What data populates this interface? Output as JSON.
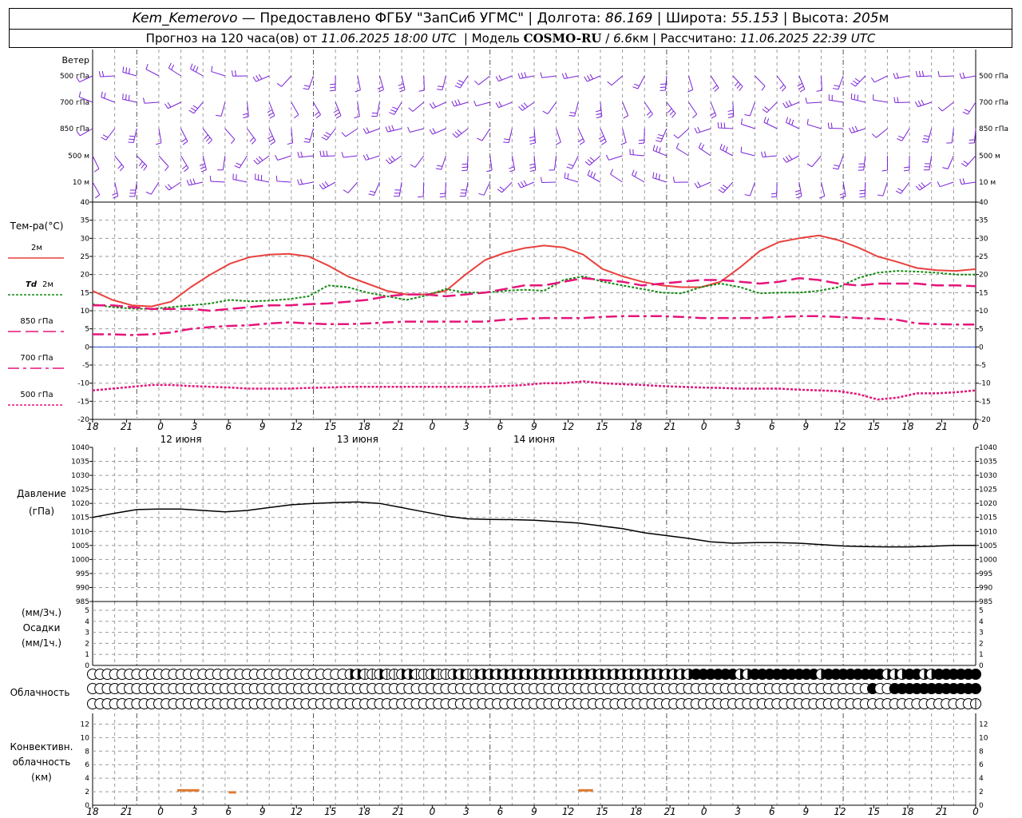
{
  "header": {
    "station": "Kem_Kemerovo",
    "dash": "—",
    "provider": "Предоставлено ФГБУ \"ЗапСиб УГМС\"",
    "lon_label": "Долгота:",
    "lon": "86.169",
    "lat_label": "Широта:",
    "lat": "55.153",
    "alt_label": "Высота:",
    "alt": "205",
    "alt_unit": "м",
    "forecast_prefix": "Прогноз на 120 часа(ов) от",
    "forecast_from": "11.06.2025 18:00 UTC",
    "model_label": "Модель",
    "model": "COSMO-RU",
    "resolution": "6.6",
    "res_unit": "км",
    "computed_label": "Рассчитано:",
    "computed": "11.06.2025 22:39 UTC"
  },
  "colors": {
    "t2m": "#e8413c",
    "td2m": "#118a11",
    "t850": "#e6147a",
    "t700": "#e6147a",
    "t500": "#e6147a",
    "wind": "#7a22d8",
    "zero_line": "#2b4fd8",
    "conv_cloud": "#e07a30",
    "pressure": "#000000",
    "grid": "#9a9a9a"
  },
  "time_axis": {
    "hour_ticks": [
      "18",
      "21",
      "0",
      "3",
      "6",
      "9",
      "12",
      "15",
      "18",
      "21",
      "0",
      "3",
      "6",
      "9",
      "12",
      "15",
      "18",
      "21",
      "0",
      "3",
      "6",
      "9",
      "12",
      "15",
      "18",
      "21",
      "0"
    ],
    "day_labels": [
      {
        "label": "12 июня",
        "hour": 12
      },
      {
        "label": "13 июня",
        "hour": 36
      },
      {
        "label": "14 июня",
        "hour": 60
      }
    ]
  },
  "wind_panel": {
    "title": "Ветер",
    "levels": [
      "500 гПа",
      "700 гПа",
      "850 гПа",
      "500 м",
      "10 м"
    ]
  },
  "temperature_panel": {
    "title": "Тем-ра(°C)",
    "legend": [
      {
        "key": "t2m",
        "label": "2м",
        "dash": "solid"
      },
      {
        "key": "td2m",
        "label_a": "Td",
        "label_b": "2м",
        "dash": "dotted"
      },
      {
        "key": "t850",
        "label": "850 гПа",
        "dash": "long-dash"
      },
      {
        "key": "t700",
        "label": "700 гПа",
        "dash": "dash-dot"
      },
      {
        "key": "t500",
        "label": "500 гПа",
        "dash": "dotted"
      }
    ],
    "ticks": [
      "40",
      "35",
      "30",
      "25",
      "20",
      "15",
      "10",
      "5",
      "0",
      "-5",
      "-10",
      "-15",
      "-20"
    ]
  },
  "pressure_panel": {
    "title": "Давление",
    "unit": "(гПа)",
    "ticks": [
      "1040",
      "1035",
      "1030",
      "1025",
      "1020",
      "1015",
      "1010",
      "1005",
      "1000",
      "995",
      "990",
      "985"
    ]
  },
  "precip_panel": {
    "line1": "(мм/3ч.)",
    "line2": "Осадки",
    "line3": "(мм/1ч.)",
    "ticks": [
      "5",
      "4",
      "3",
      "2",
      "1",
      "0"
    ]
  },
  "cloud_panel": {
    "title": "Облачность"
  },
  "convective_panel": {
    "line1": "Конвективн.",
    "line2": "облачность",
    "line3": "(км)",
    "ticks": [
      "12",
      "10",
      "8",
      "6",
      "4",
      "2",
      "0"
    ]
  },
  "chart_data": [
    {
      "type": "line",
      "name": "temperature",
      "x_unit": "hours from 11.06.2025 18:00 UTC",
      "ylim": [
        -20,
        40
      ],
      "x": [
        0,
        3,
        6,
        9,
        12,
        15,
        18,
        21,
        24,
        27,
        30,
        33,
        36,
        39,
        42,
        45,
        48,
        51,
        54,
        57,
        60,
        63,
        66,
        69,
        72,
        75,
        78,
        81,
        84,
        87,
        90,
        93,
        96,
        99,
        102,
        105,
        108,
        111,
        114,
        117,
        120
      ],
      "series": [
        {
          "name": "2м",
          "values": [
            15.5,
            13.0,
            11.5,
            11.2,
            12.5,
            16.5,
            20.0,
            23.0,
            24.8,
            25.5,
            25.7,
            25.0,
            22.5,
            19.5,
            17.5,
            15.5,
            14.5,
            14.5,
            15.5,
            20.0,
            24.0,
            26.0,
            27.3,
            28.0,
            27.5,
            25.5,
            21.5,
            19.5,
            18.0,
            17.0,
            16.5,
            16.5,
            18.0,
            22.0,
            26.5,
            29.0,
            30.0,
            30.8,
            29.5,
            27.5,
            25.0,
            23.5,
            21.8,
            21.2,
            21.0,
            21.5
          ]
        },
        {
          "name": "Td 2м",
          "values": [
            11.8,
            11.0,
            10.6,
            10.5,
            11.0,
            11.5,
            12.0,
            13.0,
            12.6,
            12.8,
            13.2,
            14.0,
            17.0,
            16.5,
            15.0,
            14.0,
            13.0,
            14.2,
            16.0,
            15.0,
            15.0,
            15.5,
            15.8,
            15.5,
            18.5,
            19.5,
            18.0,
            17.0,
            16.0,
            15.0,
            14.8,
            16.5,
            17.5,
            16.5,
            14.8,
            15.0,
            15.0,
            15.5,
            16.5,
            19.0,
            20.5,
            21.0,
            20.8,
            20.5,
            20.0,
            20.0
          ]
        },
        {
          "name": "850 гПа",
          "values": [
            11.5,
            11.5,
            11.0,
            10.5,
            10.5,
            10.5,
            10.0,
            10.5,
            11.0,
            11.5,
            11.5,
            11.8,
            12.0,
            12.5,
            13.0,
            14.0,
            14.5,
            14.5,
            14.0,
            14.5,
            15.0,
            16.0,
            17.0,
            17.0,
            18.0,
            19.0,
            18.5,
            18.0,
            17.0,
            17.5,
            18.0,
            18.5,
            18.5,
            18.0,
            17.5,
            18.0,
            19.0,
            18.5,
            17.5,
            17.0,
            17.5,
            17.5,
            17.5,
            17.0,
            17.0,
            16.8
          ]
        },
        {
          "name": "700 гПа",
          "values": [
            3.5,
            3.5,
            3.3,
            3.5,
            4.0,
            5.0,
            5.5,
            5.8,
            6.0,
            6.5,
            6.8,
            6.5,
            6.3,
            6.3,
            6.5,
            6.8,
            7.0,
            7.0,
            7.0,
            7.0,
            7.0,
            7.5,
            7.8,
            8.0,
            8.0,
            8.0,
            8.3,
            8.5,
            8.5,
            8.5,
            8.3,
            8.0,
            8.0,
            8.0,
            8.0,
            8.3,
            8.5,
            8.5,
            8.3,
            8.0,
            7.8,
            7.5,
            6.5,
            6.3,
            6.2,
            6.2
          ]
        },
        {
          "name": "500 гПа",
          "values": [
            -12.0,
            -11.5,
            -11.0,
            -10.5,
            -10.5,
            -10.8,
            -11.0,
            -11.2,
            -11.5,
            -11.5,
            -11.5,
            -11.3,
            -11.2,
            -11.0,
            -11.0,
            -11.0,
            -11.0,
            -11.0,
            -11.0,
            -11.0,
            -11.0,
            -10.8,
            -10.5,
            -10.0,
            -10.0,
            -9.5,
            -10.0,
            -10.3,
            -10.5,
            -10.8,
            -11.0,
            -11.2,
            -11.3,
            -11.5,
            -11.5,
            -11.5,
            -11.8,
            -12.0,
            -12.2,
            -13.0,
            -14.5,
            -14.0,
            -12.8,
            -12.8,
            -12.5,
            -12.0
          ]
        }
      ]
    },
    {
      "type": "line",
      "name": "pressure",
      "x_unit": "hours from 11.06.2025 18:00 UTC",
      "ylim": [
        985,
        1040
      ],
      "x": [
        0,
        3,
        6,
        9,
        12,
        15,
        18,
        21,
        24,
        27,
        30,
        33,
        36,
        39,
        42,
        45,
        48,
        51,
        54,
        57,
        60,
        63,
        66,
        69,
        72,
        75,
        78,
        81,
        84,
        87,
        90,
        93,
        96,
        99,
        102,
        105,
        108,
        111,
        114,
        117,
        120
      ],
      "series": [
        {
          "name": "Давление",
          "values": [
            1015.0,
            1016.5,
            1017.8,
            1018.0,
            1018.0,
            1017.5,
            1017.0,
            1017.5,
            1018.5,
            1019.5,
            1020.0,
            1020.3,
            1020.5,
            1020.0,
            1018.5,
            1017.0,
            1015.5,
            1014.5,
            1014.3,
            1014.2,
            1014.0,
            1013.5,
            1013.0,
            1012.0,
            1011.0,
            1009.5,
            1008.5,
            1007.5,
            1006.3,
            1005.8,
            1006.0,
            1006.0,
            1005.8,
            1005.3,
            1004.8,
            1004.6,
            1004.5,
            1004.5,
            1004.7,
            1005.0,
            1005.0
          ]
        }
      ]
    },
    {
      "type": "bar",
      "name": "convective cloudiness",
      "x_unit": "hours from 11.06.2025 18:00 UTC",
      "ylim": [
        0,
        13
      ],
      "segments": [
        {
          "from_hour": 11.5,
          "to_hour": 14.5,
          "height_km": 2.2
        },
        {
          "from_hour": 18.5,
          "to_hour": 19.5,
          "height_km": 1.9
        },
        {
          "from_hour": 66.0,
          "to_hour": 68.0,
          "height_km": 2.2
        }
      ]
    }
  ],
  "cloud_cover": {
    "upper": [
      0,
      0,
      0,
      0,
      0,
      0,
      0,
      0,
      0,
      0,
      0,
      0,
      0,
      0,
      0,
      0,
      0,
      0,
      0,
      0,
      0,
      0,
      0,
      0,
      0,
      0,
      0,
      0,
      0,
      0,
      0,
      0,
      0,
      0,
      0,
      2,
      2,
      1,
      1,
      2,
      1,
      1,
      2,
      2,
      1,
      1,
      2,
      1,
      1,
      2,
      2,
      1,
      2,
      2,
      2,
      2,
      2,
      2,
      2,
      2,
      2,
      2,
      2,
      2,
      2,
      2,
      2,
      2,
      2,
      2,
      2,
      2,
      2,
      2,
      2,
      2,
      2,
      2,
      2,
      2,
      2,
      2,
      3,
      3,
      3,
      3,
      3,
      3,
      2,
      2,
      3,
      3,
      3,
      3,
      3,
      3,
      3,
      3,
      3,
      2,
      3,
      3,
      3,
      3,
      3,
      3,
      3,
      3,
      2,
      2,
      2,
      3,
      3,
      2,
      2,
      3,
      3,
      3,
      3,
      3,
      3
    ],
    "middle": [
      0,
      0,
      0,
      0,
      0,
      0,
      0,
      0,
      0,
      0,
      0,
      0,
      0,
      0,
      0,
      0,
      0,
      0,
      0,
      0,
      0,
      0,
      0,
      0,
      0,
      0,
      0,
      0,
      0,
      0,
      0,
      0,
      0,
      0,
      0,
      0,
      0,
      0,
      0,
      0,
      0,
      0,
      0,
      0,
      0,
      0,
      0,
      0,
      0,
      0,
      0,
      0,
      0,
      0,
      0,
      0,
      0,
      0,
      0,
      0,
      0,
      0,
      0,
      0,
      0,
      0,
      0,
      0,
      0,
      0,
      0,
      0,
      0,
      0,
      0,
      0,
      0,
      0,
      0,
      0,
      0,
      0,
      0,
      0,
      0,
      0,
      0,
      0,
      0,
      0,
      0,
      0,
      0,
      0,
      0,
      0,
      0,
      0,
      0,
      0,
      0,
      0,
      0,
      0,
      0,
      0,
      3,
      0,
      0,
      3,
      3,
      3,
      3,
      3,
      3,
      3,
      3,
      3,
      3,
      3,
      3
    ],
    "lower": [
      0,
      0,
      0,
      0,
      0,
      0,
      0,
      0,
      0,
      0,
      0,
      0,
      0,
      0,
      0,
      0,
      0,
      0,
      0,
      0,
      0,
      0,
      0,
      0,
      0,
      0,
      0,
      0,
      0,
      0,
      0,
      0,
      0,
      0,
      0,
      0,
      0,
      0,
      0,
      0,
      0,
      0,
      0,
      0,
      0,
      0,
      0,
      0,
      0,
      0,
      0,
      0,
      0,
      0,
      0,
      0,
      0,
      0,
      0,
      0,
      0,
      0,
      0,
      0,
      0,
      0,
      0,
      0,
      0,
      0,
      0,
      0,
      0,
      0,
      0,
      0,
      0,
      0,
      0,
      0,
      0,
      0,
      0,
      0,
      0,
      0,
      0,
      0,
      0,
      0,
      0,
      0,
      0,
      0,
      0,
      0,
      0,
      0,
      0,
      0,
      0,
      0,
      0,
      0,
      0,
      0,
      0,
      0,
      0,
      0,
      0,
      0,
      0,
      0,
      0,
      0,
      0,
      0,
      0,
      0,
      1
    ]
  }
}
